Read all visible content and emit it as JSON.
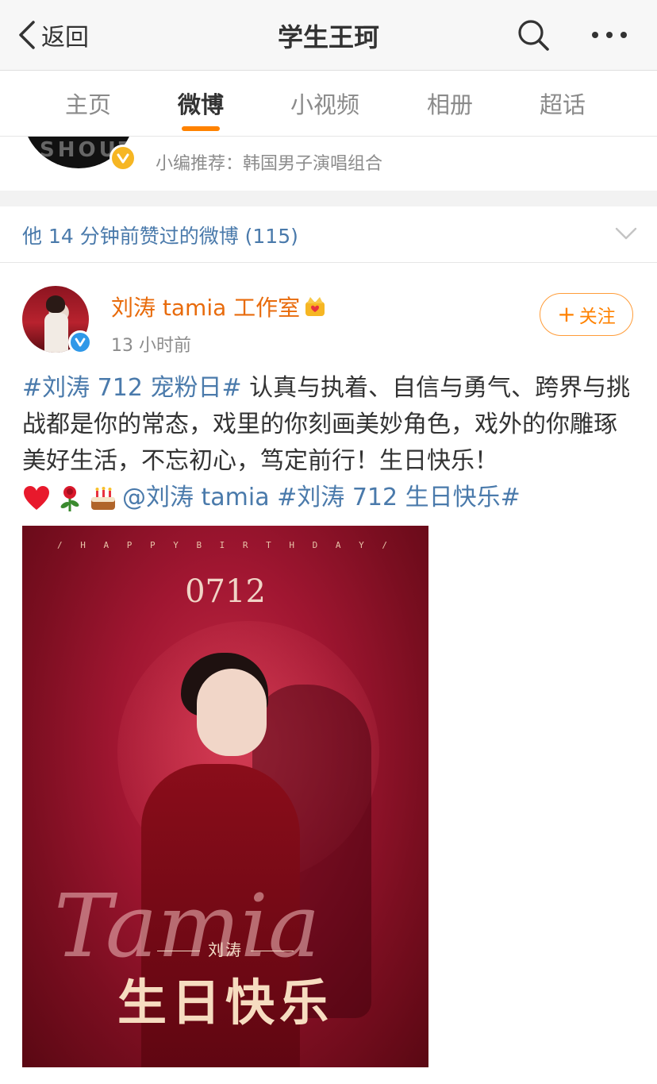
{
  "nav": {
    "back_label": "返回",
    "title": "学生王珂"
  },
  "tabs": [
    "主页",
    "微博",
    "小视频",
    "相册",
    "超话"
  ],
  "recommend": {
    "text": "小编推荐：韩国男子演唱组合",
    "logo_text": "SHOUT"
  },
  "liked_bar": {
    "text": "他 14 分钟前赞过的微博 (115)"
  },
  "post": {
    "author": "刘涛 tamia 工作室",
    "time": "13 小时前",
    "follow_label": "关注",
    "tag1": "#刘涛 712 宠粉日#",
    "body": " 认真与执着、自信与勇气、跨界与挑战都是你的常态，戏里的你刻画美妙角色，戏外的你雕琢美好生活，不忘初心，笃定前行！生日快乐！",
    "mention": "@刘涛 tamia",
    "tag2": "#刘涛 712 生日快乐#",
    "emojis": [
      "heart-icon",
      "rose-icon",
      "cake-icon"
    ]
  },
  "poster": {
    "happy_birthday": "/ H A P P Y B I R T H D A Y /",
    "date": "0712",
    "signature": "Tamia",
    "name": "刘涛",
    "greeting": "生日快乐"
  },
  "colors": {
    "accent": "#ff8200",
    "link": "#4a7aab",
    "author": "#e86b0c"
  }
}
